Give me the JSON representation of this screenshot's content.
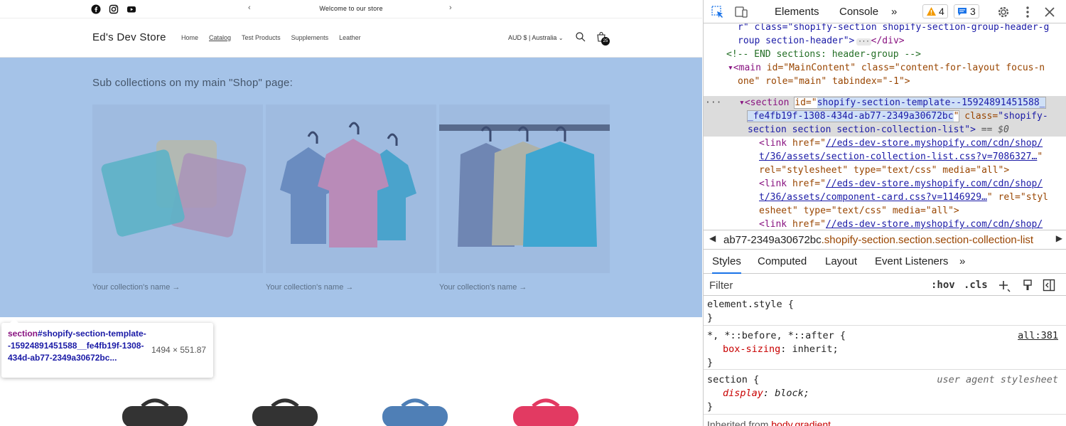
{
  "store": {
    "announcement": "Welcome to our store",
    "logo": "Ed's Dev Store",
    "nav": [
      "Home",
      "Catalog",
      "Test Products",
      "Supplements",
      "Leather"
    ],
    "currency": "AUD $ | Australia",
    "cart_count": "25",
    "section_title": "Sub collections on my main \"Shop\" page:",
    "collections": [
      {
        "label": "Your collection's name →"
      },
      {
        "label": "Your collection's name →"
      },
      {
        "label": "Your collection's name →"
      }
    ],
    "highlight_color": "#a5c3e8"
  },
  "tooltip": {
    "tag": "section",
    "selector": "#shopify-section-template--15924891451588__fe4fb19f-1308-434d-ab77-2349a30672bc...",
    "dimensions": "1494 × 551.87"
  },
  "devtools": {
    "tabs": [
      "Elements",
      "Console"
    ],
    "more": "»",
    "warnings": "4",
    "messages": "3",
    "dom_lines": [
      "r\" class=\"shopify-section shopify-section-group-header-g",
      "roup section-header\">",
      "</div>",
      "<!-- END sections: header-group -->",
      "main",
      "id=\"MainContent\" class=\"content-for-layout focus-n",
      "one\" role=\"main\" tabindex=\"-1\">",
      "section",
      "shopify-section-template--15924891451588_",
      "_fe4fb19f-1308-434d-ab77-2349a30672bc",
      "\"shopify-",
      "section section section-collection-list\">",
      "== $0",
      "//eds-dev-store.myshopify.com/cdn/shop/",
      "t/36/assets/section-collection-list.css?v=7086327…",
      "rel=\"stylesheet\" type=\"text/css\" media=\"all\">",
      "//eds-dev-store.myshopify.com/cdn/shop/",
      "t/36/assets/component-card.css?v=1146929…",
      "rel=\"styl",
      "esheet\" type=\"text/css\" media=\"all\">"
    ],
    "breadcrumb_id": "ab77-2349a30672bc",
    "breadcrumb_class": ".shopify-section.section.section-collection-list",
    "sub_tabs": [
      "Styles",
      "Computed",
      "Layout",
      "Event Listeners"
    ],
    "filter_placeholder": "Filter",
    "filter_buttons": [
      ":hov",
      ".cls"
    ],
    "rules": {
      "element_style": "element.style {",
      "universal_selector": "*, *::before, *::after {",
      "universal_prop": "box-sizing",
      "universal_val": "inherit;",
      "universal_src": "all:381",
      "section_selector": "section {",
      "section_prop": "display",
      "section_val": "block;",
      "section_src": "user agent stylesheet",
      "inherited": "Inherited from",
      "inherited_tag": "body.gradient"
    }
  }
}
